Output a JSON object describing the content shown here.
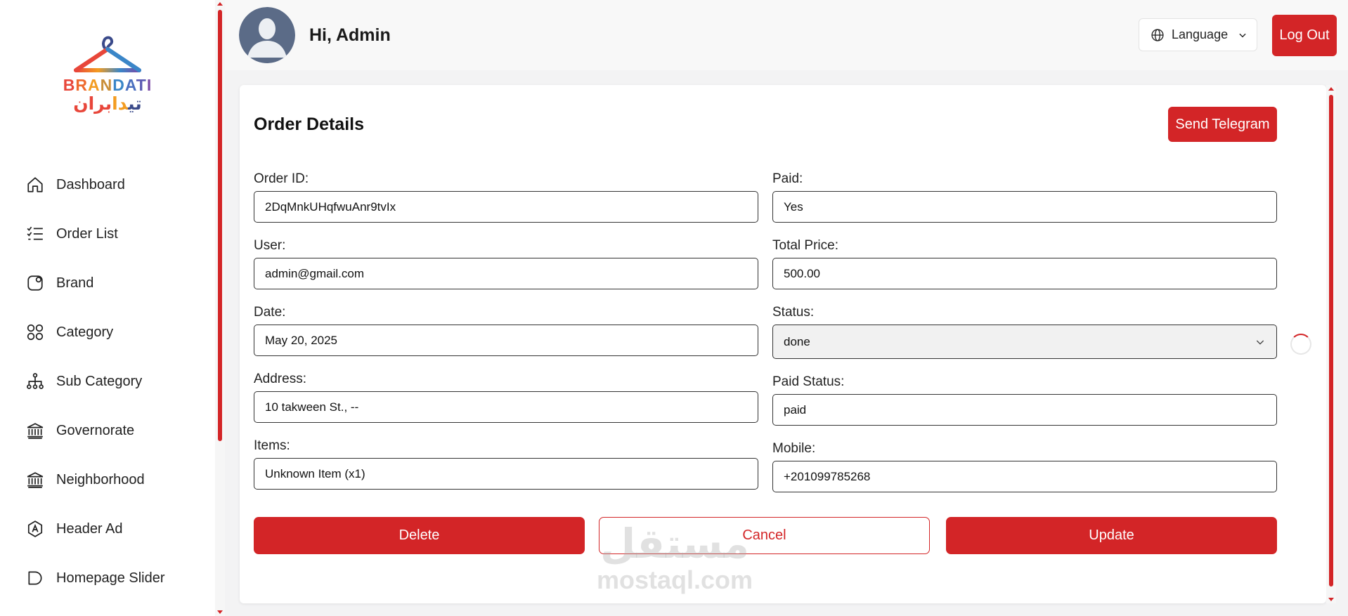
{
  "brand": {
    "name_en": "BRANDATI",
    "name_ar": "براندااتي",
    "colors": [
      "#e8463a",
      "#f39c21",
      "#3a86c8",
      "#7a4aa6"
    ]
  },
  "sidebar": {
    "items": [
      {
        "label": "Dashboard",
        "icon": "home-icon"
      },
      {
        "label": "Order List",
        "icon": "list-checks-icon"
      },
      {
        "label": "Brand",
        "icon": "brand-icon"
      },
      {
        "label": "Category",
        "icon": "grid-icon"
      },
      {
        "label": "Sub Category",
        "icon": "hierarchy-icon"
      },
      {
        "label": "Governorate",
        "icon": "bank-icon"
      },
      {
        "label": "Neighborhood",
        "icon": "bank-icon"
      },
      {
        "label": "Header Ad",
        "icon": "ad-badge-icon"
      },
      {
        "label": "Homepage Slider",
        "icon": "slider-icon"
      }
    ]
  },
  "header": {
    "greeting": "Hi, Admin",
    "language_label": "Language",
    "logout_label": "Log Out"
  },
  "order": {
    "title": "Order Details",
    "send_telegram_label": "Send Telegram",
    "fields_left": [
      {
        "label": "Order ID:",
        "value": "2DqMnkUHqfwuAnr9tvIx"
      },
      {
        "label": "User:",
        "value": "admin@gmail.com"
      },
      {
        "label": "Date:",
        "value": "May 20, 2025"
      },
      {
        "label": "Address:",
        "value": "10 takween St., --"
      },
      {
        "label": "Items:",
        "value": "Unknown Item (x1)"
      }
    ],
    "fields_right": [
      {
        "label": "Paid:",
        "value": "Yes"
      },
      {
        "label": "Total Price:",
        "value": "500.00"
      },
      {
        "label": "Status:",
        "value": "done"
      },
      {
        "label": "Paid Status:",
        "value": "paid"
      },
      {
        "label": "Mobile:",
        "value": "+201099785268"
      }
    ],
    "actions": {
      "delete_label": "Delete",
      "cancel_label": "Cancel",
      "update_label": "Update"
    }
  },
  "watermark": {
    "ar": "مستقل",
    "en": "mostaql.com"
  },
  "accent_color": "#d32527"
}
